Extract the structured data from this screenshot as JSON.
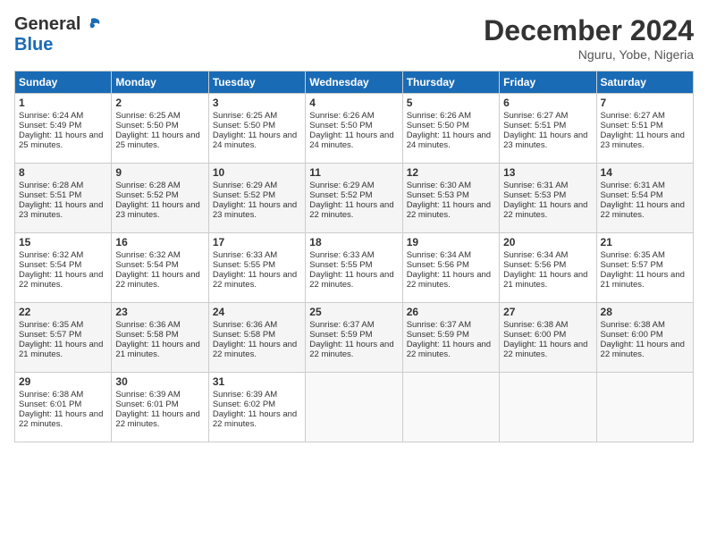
{
  "logo": {
    "general": "General",
    "blue": "Blue"
  },
  "title": "December 2024",
  "location": "Nguru, Yobe, Nigeria",
  "weekdays": [
    "Sunday",
    "Monday",
    "Tuesday",
    "Wednesday",
    "Thursday",
    "Friday",
    "Saturday"
  ],
  "weeks": [
    [
      {
        "day": "1",
        "sunrise": "6:24 AM",
        "sunset": "5:49 PM",
        "daylight": "11 hours and 25 minutes."
      },
      {
        "day": "2",
        "sunrise": "6:25 AM",
        "sunset": "5:50 PM",
        "daylight": "11 hours and 25 minutes."
      },
      {
        "day": "3",
        "sunrise": "6:25 AM",
        "sunset": "5:50 PM",
        "daylight": "11 hours and 24 minutes."
      },
      {
        "day": "4",
        "sunrise": "6:26 AM",
        "sunset": "5:50 PM",
        "daylight": "11 hours and 24 minutes."
      },
      {
        "day": "5",
        "sunrise": "6:26 AM",
        "sunset": "5:50 PM",
        "daylight": "11 hours and 24 minutes."
      },
      {
        "day": "6",
        "sunrise": "6:27 AM",
        "sunset": "5:51 PM",
        "daylight": "11 hours and 23 minutes."
      },
      {
        "day": "7",
        "sunrise": "6:27 AM",
        "sunset": "5:51 PM",
        "daylight": "11 hours and 23 minutes."
      }
    ],
    [
      {
        "day": "8",
        "sunrise": "6:28 AM",
        "sunset": "5:51 PM",
        "daylight": "11 hours and 23 minutes."
      },
      {
        "day": "9",
        "sunrise": "6:28 AM",
        "sunset": "5:52 PM",
        "daylight": "11 hours and 23 minutes."
      },
      {
        "day": "10",
        "sunrise": "6:29 AM",
        "sunset": "5:52 PM",
        "daylight": "11 hours and 23 minutes."
      },
      {
        "day": "11",
        "sunrise": "6:29 AM",
        "sunset": "5:52 PM",
        "daylight": "11 hours and 22 minutes."
      },
      {
        "day": "12",
        "sunrise": "6:30 AM",
        "sunset": "5:53 PM",
        "daylight": "11 hours and 22 minutes."
      },
      {
        "day": "13",
        "sunrise": "6:31 AM",
        "sunset": "5:53 PM",
        "daylight": "11 hours and 22 minutes."
      },
      {
        "day": "14",
        "sunrise": "6:31 AM",
        "sunset": "5:54 PM",
        "daylight": "11 hours and 22 minutes."
      }
    ],
    [
      {
        "day": "15",
        "sunrise": "6:32 AM",
        "sunset": "5:54 PM",
        "daylight": "11 hours and 22 minutes."
      },
      {
        "day": "16",
        "sunrise": "6:32 AM",
        "sunset": "5:54 PM",
        "daylight": "11 hours and 22 minutes."
      },
      {
        "day": "17",
        "sunrise": "6:33 AM",
        "sunset": "5:55 PM",
        "daylight": "11 hours and 22 minutes."
      },
      {
        "day": "18",
        "sunrise": "6:33 AM",
        "sunset": "5:55 PM",
        "daylight": "11 hours and 22 minutes."
      },
      {
        "day": "19",
        "sunrise": "6:34 AM",
        "sunset": "5:56 PM",
        "daylight": "11 hours and 22 minutes."
      },
      {
        "day": "20",
        "sunrise": "6:34 AM",
        "sunset": "5:56 PM",
        "daylight": "11 hours and 21 minutes."
      },
      {
        "day": "21",
        "sunrise": "6:35 AM",
        "sunset": "5:57 PM",
        "daylight": "11 hours and 21 minutes."
      }
    ],
    [
      {
        "day": "22",
        "sunrise": "6:35 AM",
        "sunset": "5:57 PM",
        "daylight": "11 hours and 21 minutes."
      },
      {
        "day": "23",
        "sunrise": "6:36 AM",
        "sunset": "5:58 PM",
        "daylight": "11 hours and 21 minutes."
      },
      {
        "day": "24",
        "sunrise": "6:36 AM",
        "sunset": "5:58 PM",
        "daylight": "11 hours and 22 minutes."
      },
      {
        "day": "25",
        "sunrise": "6:37 AM",
        "sunset": "5:59 PM",
        "daylight": "11 hours and 22 minutes."
      },
      {
        "day": "26",
        "sunrise": "6:37 AM",
        "sunset": "5:59 PM",
        "daylight": "11 hours and 22 minutes."
      },
      {
        "day": "27",
        "sunrise": "6:38 AM",
        "sunset": "6:00 PM",
        "daylight": "11 hours and 22 minutes."
      },
      {
        "day": "28",
        "sunrise": "6:38 AM",
        "sunset": "6:00 PM",
        "daylight": "11 hours and 22 minutes."
      }
    ],
    [
      {
        "day": "29",
        "sunrise": "6:38 AM",
        "sunset": "6:01 PM",
        "daylight": "11 hours and 22 minutes."
      },
      {
        "day": "30",
        "sunrise": "6:39 AM",
        "sunset": "6:01 PM",
        "daylight": "11 hours and 22 minutes."
      },
      {
        "day": "31",
        "sunrise": "6:39 AM",
        "sunset": "6:02 PM",
        "daylight": "11 hours and 22 minutes."
      },
      null,
      null,
      null,
      null
    ]
  ],
  "labels": {
    "sunrise": "Sunrise:",
    "sunset": "Sunset:",
    "daylight": "Daylight:"
  }
}
